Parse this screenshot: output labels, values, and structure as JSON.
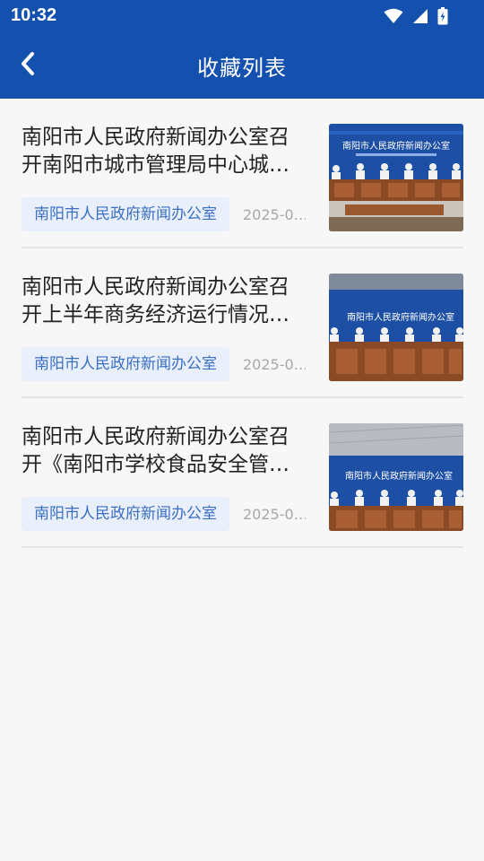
{
  "status_bar": {
    "time": "10:32",
    "icons": [
      "wifi-icon",
      "signal-icon",
      "battery-charging-icon"
    ]
  },
  "header": {
    "title": "收藏列表",
    "back_icon": "chevron-left-icon",
    "background": "#1450ad"
  },
  "favorites": [
    {
      "title": "南阳市人民政府新闻办公室召开南阳市城市管理局中心城…",
      "source": "南阳市人民政府新闻办公室",
      "date": "2025-0…",
      "thumb_banner": "南阳市人民政府新闻办公室"
    },
    {
      "title": "南阳市人民政府新闻办公室召开上半年商务经济运行情况…",
      "source": "南阳市人民政府新闻办公室",
      "date": "2025-0…",
      "thumb_banner": "南阳市人民政府新闻办公室"
    },
    {
      "title": "南阳市人民政府新闻办公室召开《南阳市学校食品安全管…",
      "source": "南阳市人民政府新闻办公室",
      "date": "2025-0…",
      "thumb_banner": "南阳市人民政府新闻办公室"
    }
  ],
  "colors": {
    "accent": "#1450ad",
    "tag_bg": "#e9effb",
    "tag_text": "#3a6fc3"
  }
}
